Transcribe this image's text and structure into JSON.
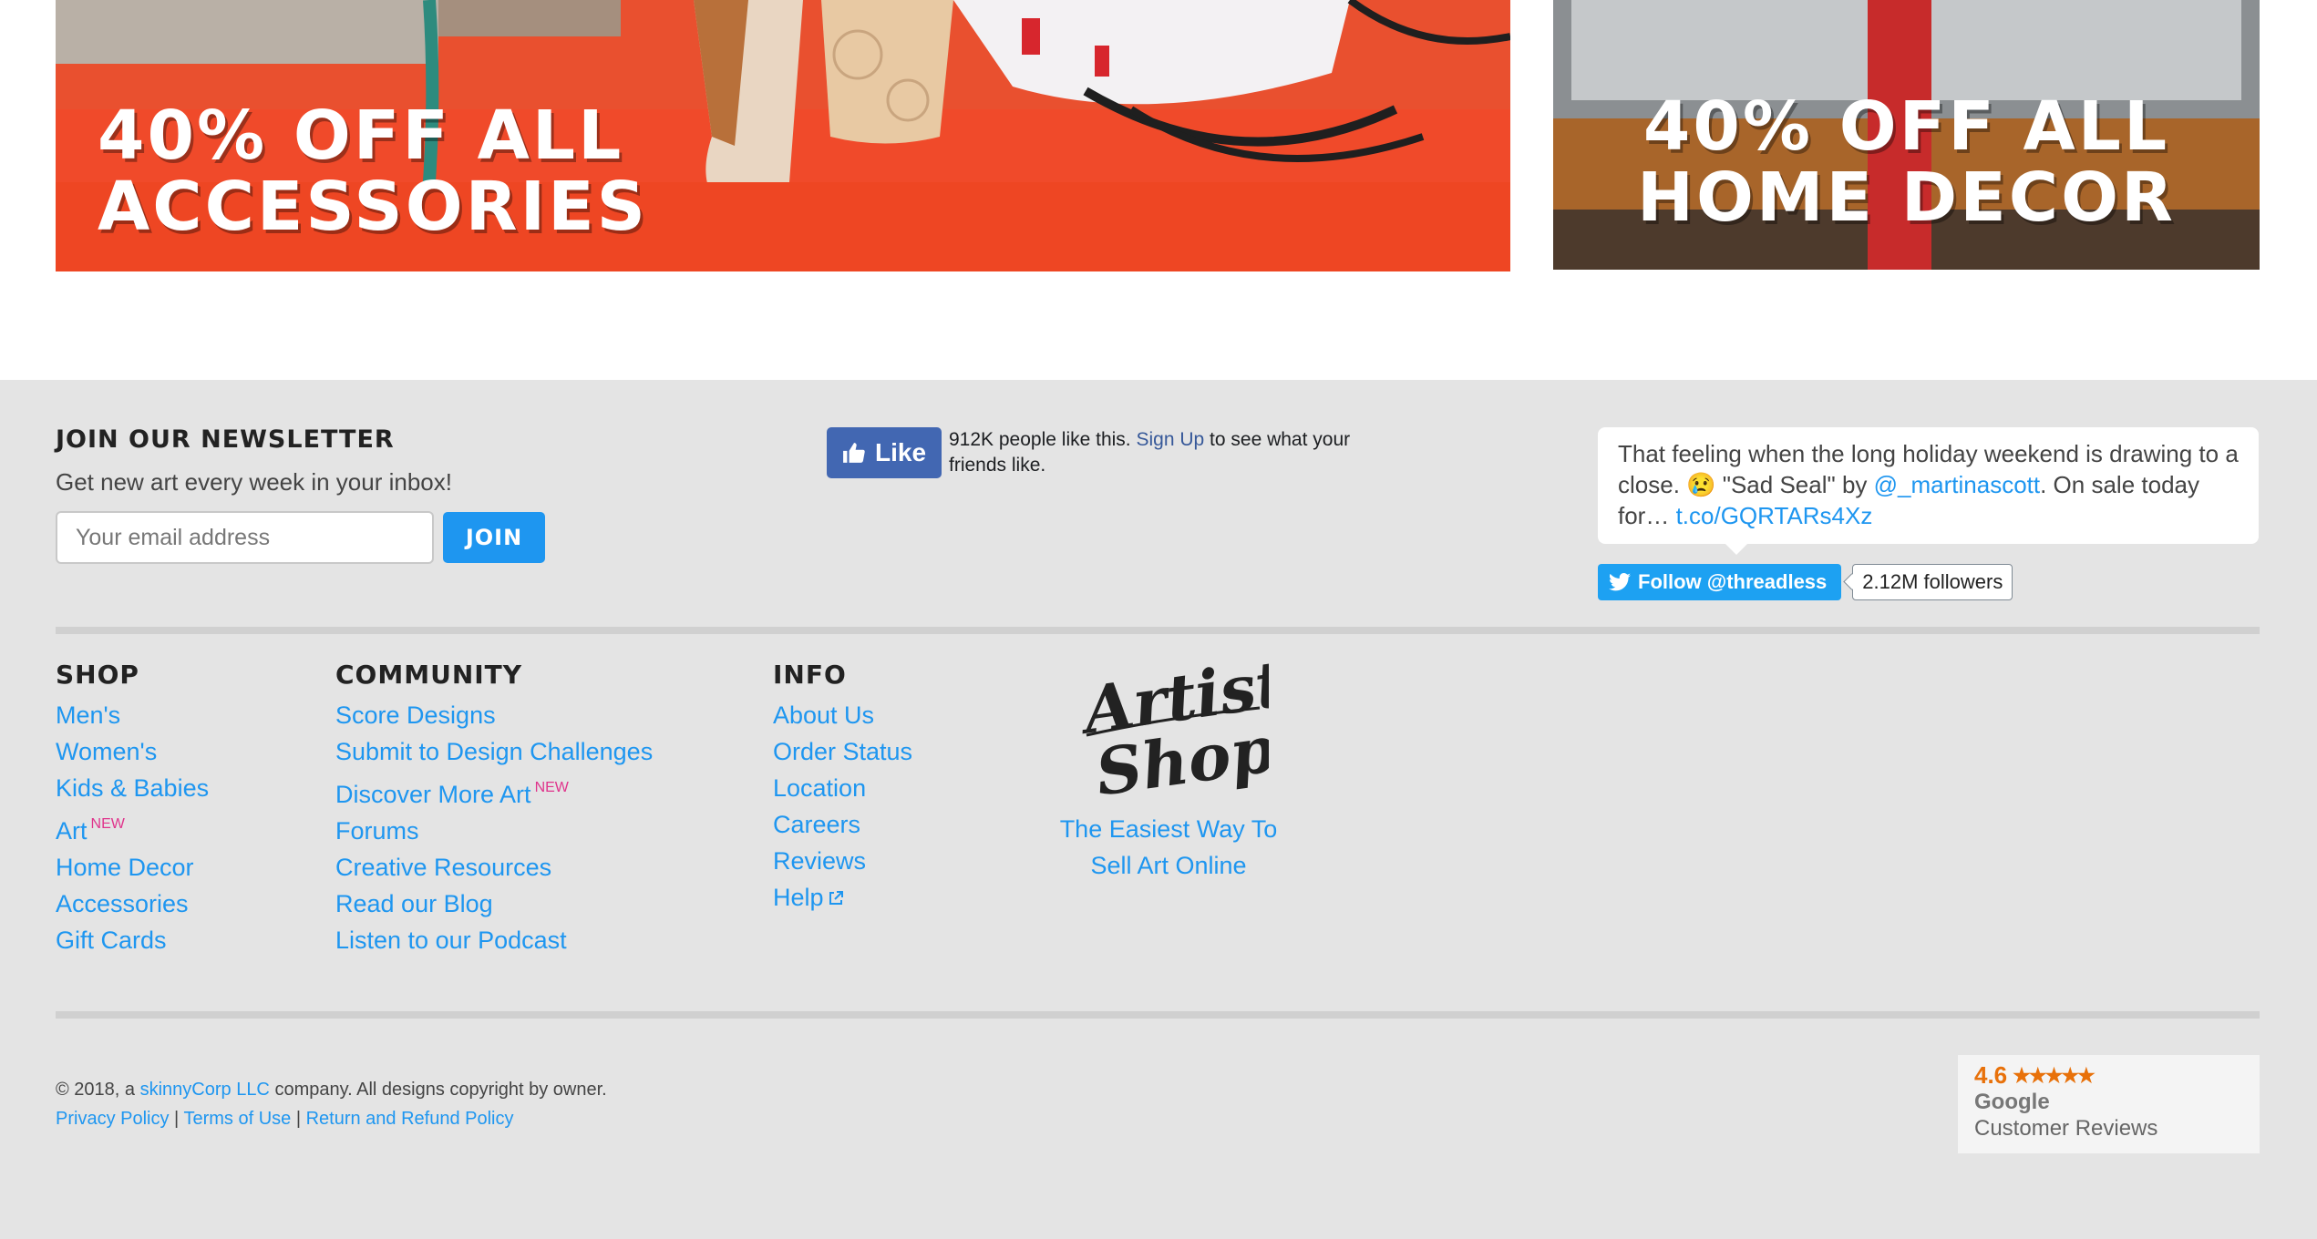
{
  "banners": {
    "accessories": {
      "line1": "40% OFF ALL",
      "line2": "ACCESSORIES"
    },
    "home_decor": {
      "line1": "40% OFF ALL",
      "line2": "HOME DECOR"
    }
  },
  "newsletter": {
    "heading": "JOIN OUR NEWSLETTER",
    "subtext": "Get new art every week in your inbox!",
    "email_placeholder": "Your email address",
    "join_label": "JOIN"
  },
  "facebook": {
    "like_label": "Like",
    "count_text": "912K people like this.",
    "signup_link": "Sign Up",
    "suffix_text": "to see what your friends like."
  },
  "twitter": {
    "tweet_text_1": "That feeling when the long holiday weekend is drawing to a close. 😢 \"Sad Seal\" by",
    "tweet_handle": "@_martinascott",
    "tweet_text_2": ". On sale today for…",
    "tweet_link": "t.co/GQRTARs4Xz",
    "follow_label": "Follow @threadless",
    "followers": "2.12M followers"
  },
  "shop": {
    "heading": "SHOP",
    "items": [
      "Men's",
      "Women's",
      "Kids & Babies",
      "Art",
      "Home Decor",
      "Accessories",
      "Gift Cards"
    ],
    "new_tag": "NEW"
  },
  "community": {
    "heading": "COMMUNITY",
    "items": [
      "Score Designs",
      "Submit to Design Challenges",
      "Discover More Art",
      "Forums",
      "Creative Resources",
      "Read our Blog",
      "Listen to our Podcast"
    ],
    "new_tag": "NEW"
  },
  "info": {
    "heading": "INFO",
    "items": [
      "About Us",
      "Order Status",
      "Location",
      "Careers",
      "Reviews",
      "Help"
    ]
  },
  "artist_shops": {
    "logo_line1": "Artist",
    "logo_line2": "Shops",
    "tagline_1": "The Easiest Way To",
    "tagline_2": "Sell Art Online"
  },
  "legal": {
    "copyright_prefix": "© 2018, a",
    "company_link": "skinnyCorp LLC",
    "copyright_suffix": "company. All designs copyright by owner.",
    "privacy": "Privacy Policy",
    "terms": "Terms of Use",
    "refund": "Return and Refund Policy",
    "separator": "|"
  },
  "google_badge": {
    "rating": "4.6",
    "stars": "★★★★★",
    "brand": "Google",
    "label": "Customer Reviews"
  },
  "colors": {
    "link": "#1e96f0",
    "footer_bg": "#e4e4e4",
    "join_button": "#1e96f0",
    "facebook": "#4267b2",
    "twitter": "#1da1f2",
    "new_tag": "#e0348c",
    "accessories_banner": "#f04a2a",
    "rating_orange": "#e8710a"
  },
  "icons": [
    "thumbs-up-icon",
    "twitter-bird-icon",
    "external-link-icon",
    "star-icon"
  ]
}
